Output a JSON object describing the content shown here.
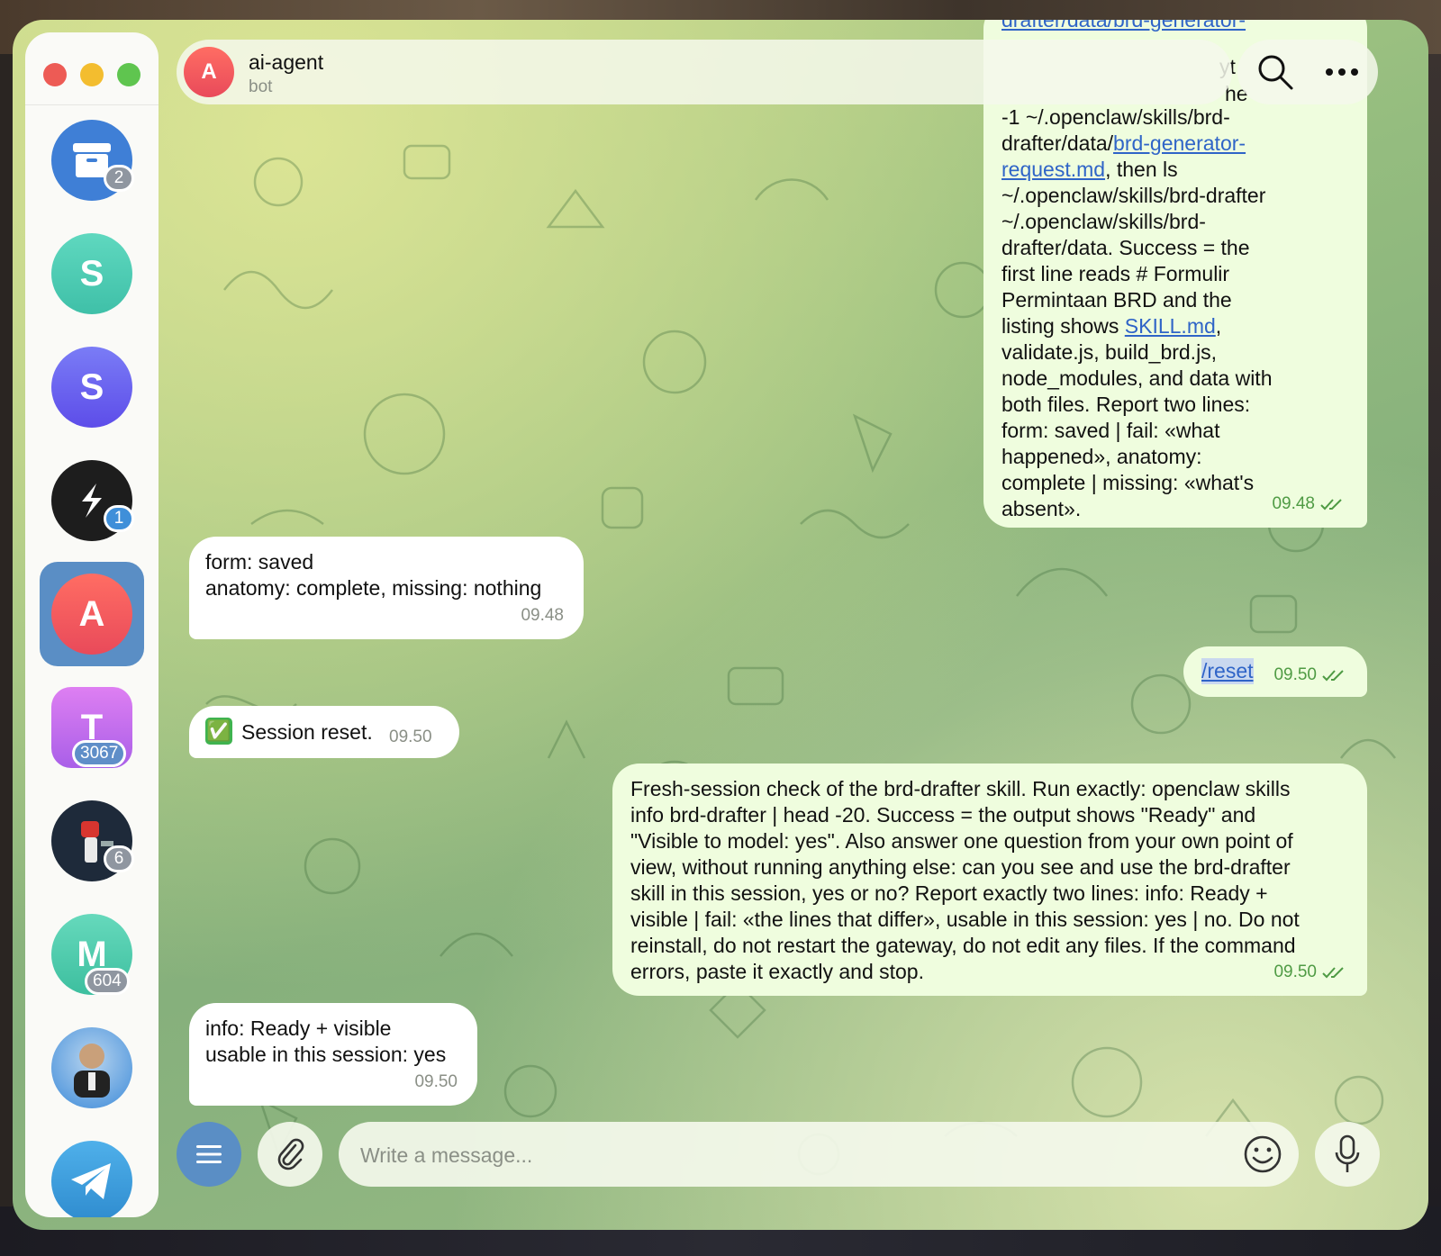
{
  "chat": {
    "name": "ai-agent",
    "status": "bot",
    "avatar_letter": "A"
  },
  "sidebar": {
    "items": [
      {
        "icon": "archive-icon",
        "badge": "2",
        "color": "#3f7fd6"
      },
      {
        "letter": "S",
        "color": "#4fcfb5"
      },
      {
        "letter": "S",
        "color": "#6c5ff0"
      },
      {
        "icon": "stripe-logo-icon",
        "badge": "1",
        "color": "#1d1d1d"
      },
      {
        "letter": "A",
        "color": "#f25b5b",
        "active": true
      },
      {
        "letter": "T",
        "badge": "3067",
        "color": "#c26df0"
      },
      {
        "icon": "fist-avatar-icon",
        "badge": "6",
        "color": "#1e2a3a"
      },
      {
        "letter": "M",
        "badge": "604",
        "color": "#4cc9ae"
      },
      {
        "icon": "person-avatar-icon",
        "color": "#3d8bd9"
      },
      {
        "icon": "telegram-icon",
        "color": "#3a97d8"
      }
    ]
  },
  "messages": {
    "m1": {
      "partial_top": "drafter/data/brd-generator-",
      "partial_line2": "yt",
      "partial_line3": "he",
      "text_a": "-1 ~/.openclaw/skills/brd-\ndrafter/data/",
      "link_a": "brd-generator-\nrequest.md",
      "text_b": ", then ls\n~/.openclaw/skills/brd-drafter\n~/.openclaw/skills/brd-\ndrafter/data. Success = the\nfirst line reads # Formulir\nPermintaan BRD and the\nlisting shows ",
      "link_b": "SKILL.md",
      "text_c": ",\nvalidate.js, build_brd.js,\nnode_modules, and data with\nboth files. Report two lines:\nform: saved | fail: «what\nhappened», anatomy:\ncomplete | missing: «what's\nabsent».",
      "time": "09.48"
    },
    "m2": {
      "text": "form: saved\nanatomy: complete, missing: nothing",
      "time": "09.48"
    },
    "m3": {
      "text": "/reset",
      "time": "09.50"
    },
    "m4": {
      "emoji": "✅",
      "text": "Session reset.",
      "time": "09.50"
    },
    "m5": {
      "text": "Fresh-session check of the brd-drafter skill. Run exactly: openclaw skills\ninfo brd-drafter | head -20. Success = the output shows \"Ready\" and\n\"Visible to model: yes\". Also answer one question from your own point of\nview, without running anything else: can you see and use the brd-drafter\nskill in this session, yes or no? Report exactly two lines: info: Ready +\nvisible | fail: «the lines that differ», usable in this session: yes | no. Do not\nreinstall, do not restart the gateway, do not edit any files. If the command\nerrors, paste it exactly and stop.",
      "time": "09.50"
    },
    "m6": {
      "text": "info: Ready + visible\nusable in this session: yes",
      "time": "09.50"
    }
  },
  "composer": {
    "placeholder": "Write a message..."
  },
  "colors": {
    "outgoing_bubble": "#effdde",
    "incoming_bubble": "#ffffff",
    "accent": "#5a8ec5",
    "link": "#2f64c7",
    "read_check": "#4f9b44"
  }
}
